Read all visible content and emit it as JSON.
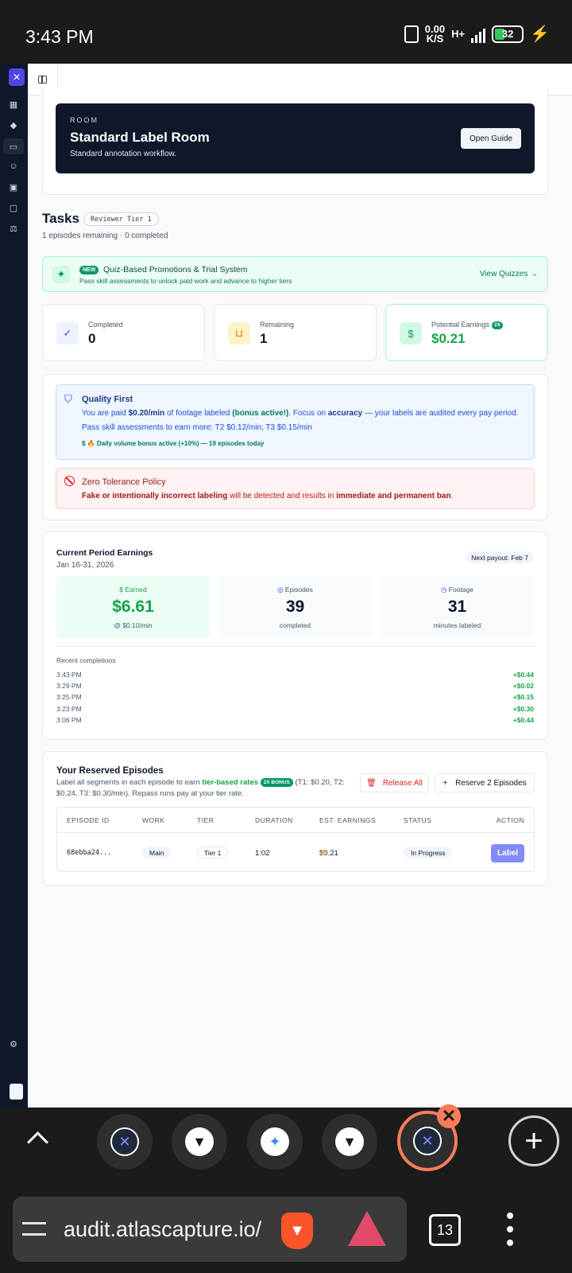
{
  "status_bar": {
    "time": "3:43 PM",
    "speed_value": "0.00",
    "speed_unit": "K/S",
    "network": "H+",
    "battery": "32"
  },
  "room": {
    "kicker": "ROOM",
    "title": "Standard Label Room",
    "description": "Standard annotation workflow.",
    "guide_button": "Open Guide"
  },
  "tasks": {
    "title": "Tasks",
    "tier": "Reviewer Tier 1",
    "subtitle": "1 episodes remaining · 0 completed"
  },
  "promo": {
    "badge": "NEW",
    "title": "Quiz-Based Promotions & Trial System",
    "subtitle": "Pass skill assessments to unlock paid work and advance to higher tiers",
    "link": "View Quizzes →"
  },
  "stats": [
    {
      "label": "Completed",
      "value": "0"
    },
    {
      "label": "Remaining",
      "value": "1"
    },
    {
      "label": "Potential Earnings",
      "badge": "2X",
      "value": "$0.21"
    }
  ],
  "quality": {
    "title": "Quality First",
    "line1_a": "You are paid ",
    "line1_rate": "$0.20/min",
    "line1_b": " of footage labeled ",
    "line1_bonus": "(bonus active!)",
    "line1_c": ". Focus on ",
    "line1_accuracy": "accuracy",
    "line1_d": " — your labels are audited every pay period.",
    "line2": "Pass skill assessments to earn more: T2 $0.12/min, T3 $0.15/min",
    "line3": "🔥 Daily volume bonus active (+10%) — 19 episodes today"
  },
  "zero": {
    "title": "Zero Tolerance Policy",
    "a": "Fake or intentionally incorrect labeling",
    "b": " will be detected and results in ",
    "c": "immediate and permanent ban",
    "d": "."
  },
  "period": {
    "title": "Current Period Earnings",
    "dates": "Jan 16-31, 2026",
    "payout": "Next payout: Feb 7",
    "boxes": [
      {
        "label": "Earned",
        "value": "$6.61",
        "sub": "@ $0.10/min"
      },
      {
        "label": "Episodes",
        "value": "39",
        "sub": "completed"
      },
      {
        "label": "Footage",
        "value": "31",
        "sub": "minutes labeled"
      }
    ],
    "recent_title": "Recent completions",
    "recent": [
      {
        "time": "3:43 PM",
        "amount": "+$0.44"
      },
      {
        "time": "3:29 PM",
        "amount": "+$0.02"
      },
      {
        "time": "3:25 PM",
        "amount": "+$0.15"
      },
      {
        "time": "3:23 PM",
        "amount": "+$0.30"
      },
      {
        "time": "3:06 PM",
        "amount": "+$0.44"
      }
    ]
  },
  "reserved": {
    "title": "Your Reserved Episodes",
    "desc_a": "Label all segments in each episode to earn ",
    "desc_rates": "tier-based rates",
    "desc_badge": "2X BONUS",
    "desc_b": " (T1: $0.20, T2:",
    "desc_line2": "$0.24, T3: $0.30/min).  Repass runs pay at your tier rate.",
    "release_button": "Release All",
    "reserve_button": "Reserve 2 Episodes",
    "columns": [
      "EPISODE ID",
      "WORK",
      "TIER",
      "DURATION",
      "EST. EARNINGS",
      "STATUS",
      "ACTION"
    ],
    "rows": [
      {
        "id": "68ebba24...",
        "work": "Main",
        "tier": "Tier 1",
        "duration": "1:02",
        "earnings": "$0.21",
        "status": "In Progress",
        "action": "Label"
      }
    ]
  },
  "browser": {
    "url": "audit.atlascapture.io/",
    "tab_count": "13"
  },
  "colors": {
    "accent": "#4f46e5",
    "success": "#16a34a",
    "danger": "#dc2626",
    "brave": "#fb542b"
  }
}
